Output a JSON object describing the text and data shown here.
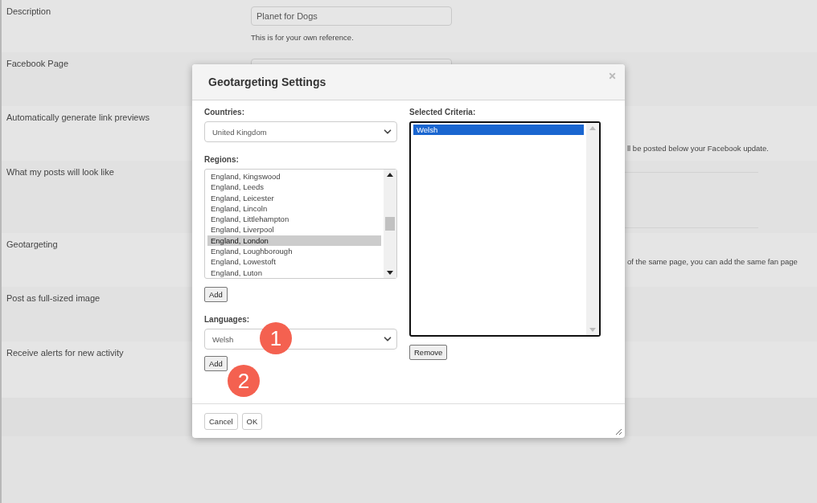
{
  "settings_rows": [
    {
      "label": "Description",
      "field_value": "Planet for Dogs",
      "help": "This is for your own reference."
    },
    {
      "label": "Facebook Page",
      "kind": "field"
    },
    {
      "label": "Automatically generate link previews",
      "help_partial": "ll be posted below your Facebook update."
    },
    {
      "label": "What my posts will look like",
      "kind": "preview"
    },
    {
      "label": "Geotargeting",
      "help_partial": "of the same page, you can add the same fan page"
    },
    {
      "label": "Post as full-sized image"
    },
    {
      "label": "Receive alerts for new activity"
    }
  ],
  "dialog": {
    "title": "Geotargeting Settings",
    "countries": {
      "label": "Countries:",
      "value": "United Kingdom"
    },
    "regions": {
      "label": "Regions:",
      "items": [
        {
          "label": "England, Kingswood",
          "selected": false
        },
        {
          "label": "England, Leeds",
          "selected": false
        },
        {
          "label": "England, Leicester",
          "selected": false
        },
        {
          "label": "England, Lincoln",
          "selected": false
        },
        {
          "label": "England, Littlehampton",
          "selected": false
        },
        {
          "label": "England, Liverpool",
          "selected": false
        },
        {
          "label": "England, London",
          "selected": true
        },
        {
          "label": "England, Loughborough",
          "selected": false
        },
        {
          "label": "England, Lowestoft",
          "selected": false
        },
        {
          "label": "England, Luton",
          "selected": false
        }
      ],
      "add_button": "Add"
    },
    "languages": {
      "label": "Languages:",
      "value": "Welsh",
      "add_button": "Add"
    },
    "selected_criteria": {
      "label": "Selected Criteria:",
      "items": [
        {
          "label": "Welsh",
          "selected": true
        }
      ],
      "remove_button": "Remove"
    },
    "buttons": [
      "Cancel",
      "OK"
    ]
  },
  "annotations": [
    "1",
    "2"
  ]
}
